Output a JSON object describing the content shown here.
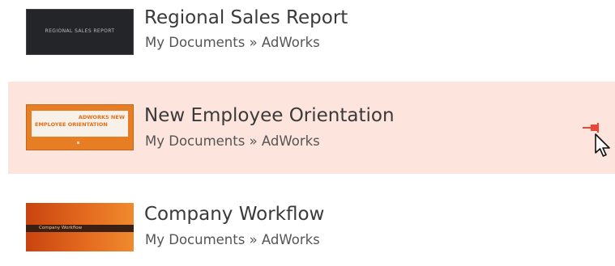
{
  "recent_documents": [
    {
      "title": "Regional Sales Report",
      "path": "My Documents » AdWorks",
      "thumbnail_text": "REGIONAL SALES REPORT"
    },
    {
      "title": "New Employee Orientation",
      "path": "My Documents » AdWorks",
      "thumbnail_text_1": "ADWORKS NEW",
      "thumbnail_text_2": "EMPLOYEE ORIENTATION",
      "selected": true
    },
    {
      "title": "Company Workflow",
      "path": "My Documents » AdWorks",
      "thumbnail_text": "Company Workflow"
    }
  ],
  "colors": {
    "selected_background": "#fde4dc",
    "pin_accent": "#e8473a",
    "thumbnail_orange": "#e77e24"
  },
  "icons": {
    "pin": "pin-icon",
    "cursor": "mouse-cursor-icon"
  }
}
